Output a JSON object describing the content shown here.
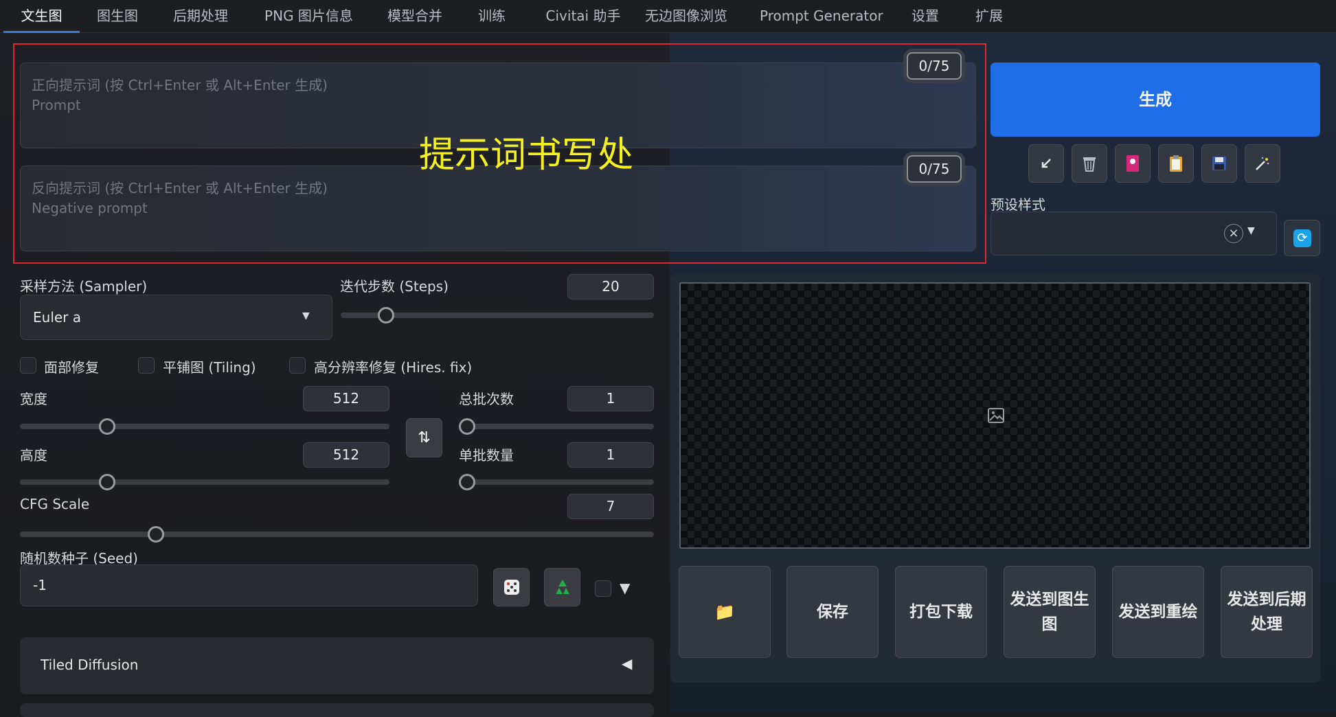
{
  "tabs": [
    "文生图",
    "图生图",
    "后期处理",
    "PNG 图片信息",
    "模型合并",
    "训练",
    "Civitai 助手",
    "无边图像浏览",
    "Prompt Generator",
    "设置",
    "扩展"
  ],
  "prompt": {
    "positive_placeholder": "正向提示词 (按 Ctrl+Enter 或 Alt+Enter 生成)",
    "positive_placeholder_en": "Prompt",
    "negative_placeholder": "反向提示词 (按 Ctrl+Enter 或 Alt+Enter 生成)",
    "negative_placeholder_en": "Negative prompt",
    "positive_count": "0/75",
    "negative_count": "0/75"
  },
  "annotation": "提示词书写处",
  "generate_label": "生成",
  "toolbar_icons": [
    "arrow-icon",
    "trash-icon",
    "card-icon",
    "clipboard-icon",
    "save-icon",
    "magic-icon"
  ],
  "styles": {
    "label": "预设样式"
  },
  "sampler": {
    "label": "采样方法 (Sampler)",
    "value": "Euler a"
  },
  "steps": {
    "label": "迭代步数 (Steps)",
    "value": "20"
  },
  "checkboxes": {
    "face": "面部修复",
    "tiling": "平铺图 (Tiling)",
    "hires": "高分辨率修复 (Hires. fix)"
  },
  "width": {
    "label": "宽度",
    "value": "512"
  },
  "height": {
    "label": "高度",
    "value": "512"
  },
  "batch_count": {
    "label": "总批次数",
    "value": "1"
  },
  "batch_size": {
    "label": "单批数量",
    "value": "1"
  },
  "cfg": {
    "label": "CFG Scale",
    "value": "7"
  },
  "seed": {
    "label": "随机数种子 (Seed)",
    "value": "-1"
  },
  "tiled_diffusion": {
    "label": "Tiled Diffusion"
  },
  "actions": {
    "folder_icon": "📁",
    "save": "保存",
    "zip": "打包下载",
    "to_img2img": "发送到图生图",
    "to_inpaint": "发送到重绘",
    "to_extras": "发送到后期处理"
  },
  "colors": {
    "accent": "#1f6ee8",
    "annotation": "#f5f020",
    "frame": "#e0272f"
  }
}
